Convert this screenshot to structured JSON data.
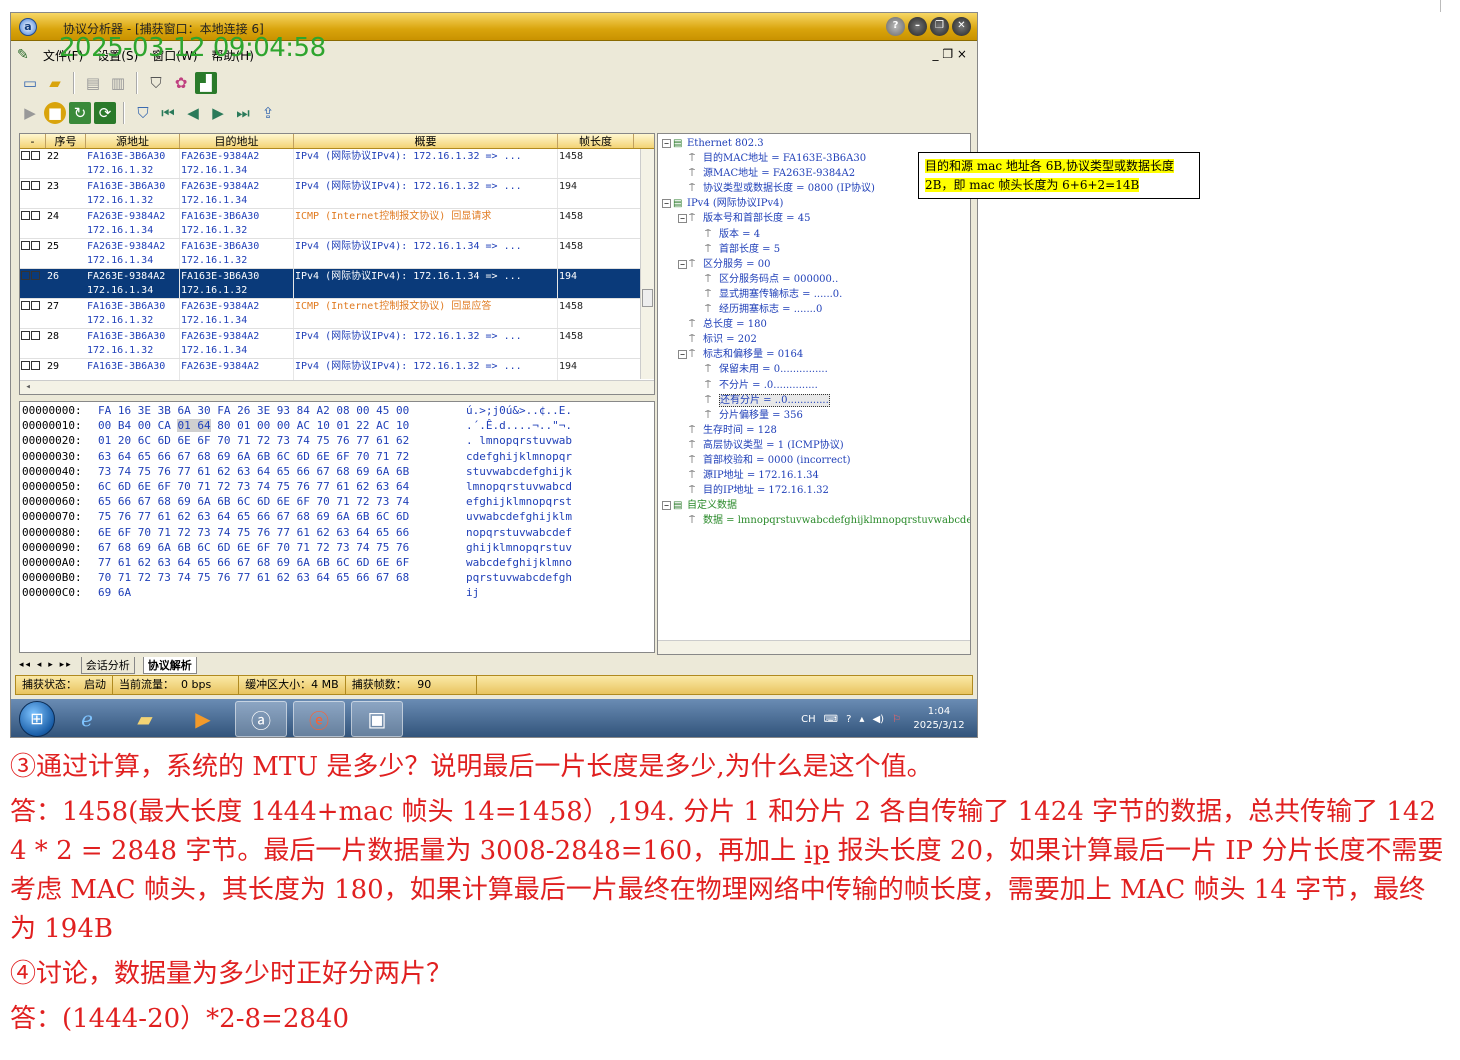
{
  "window": {
    "title": "协议分析器 - [捕获窗口：本地连接 6]",
    "timestamp_overlay": "2025-03-12 09:04:58",
    "buttons": [
      "?",
      "–",
      "❐",
      "✕"
    ]
  },
  "menu": {
    "items": [
      "文件(F)",
      "设置(S)",
      "窗口(W)",
      "帮助(H)"
    ],
    "mdi_controls": "_ ❐ ×"
  },
  "packet_list": {
    "columns": [
      "-",
      "序号",
      "源地址",
      "目的地址",
      "概要",
      "帧长度"
    ],
    "rows": [
      {
        "no": "22",
        "src": "FA163E-3B6A30",
        "src_ip": "172.16.1.32",
        "dst": "FA263E-9384A2",
        "dst_ip": "172.16.1.34",
        "summary": "IPv4 (网际协议IPv4): 172.16.1.32 => ...",
        "len": "1458",
        "type": "ipv4"
      },
      {
        "no": "23",
        "src": "FA163E-3B6A30",
        "src_ip": "172.16.1.32",
        "dst": "FA263E-9384A2",
        "dst_ip": "172.16.1.34",
        "summary": "IPv4 (网际协议IPv4): 172.16.1.32 => ...",
        "len": "194",
        "type": "ipv4"
      },
      {
        "no": "24",
        "src": "FA263E-9384A2",
        "src_ip": "172.16.1.34",
        "dst": "FA163E-3B6A30",
        "dst_ip": "172.16.1.32",
        "summary": "ICMP (Internet控制报文协议) 回显请求",
        "len": "1458",
        "type": "icmp"
      },
      {
        "no": "25",
        "src": "FA263E-9384A2",
        "src_ip": "172.16.1.34",
        "dst": "FA163E-3B6A30",
        "dst_ip": "172.16.1.32",
        "summary": "IPv4 (网际协议IPv4): 172.16.1.34 => ...",
        "len": "1458",
        "type": "ipv4"
      },
      {
        "no": "26",
        "src": "FA263E-9384A2",
        "src_ip": "172.16.1.34",
        "dst": "FA163E-3B6A30",
        "dst_ip": "172.16.1.32",
        "summary": "IPv4 (网际协议IPv4): 172.16.1.34 => ...",
        "len": "194",
        "type": "selected"
      },
      {
        "no": "27",
        "src": "FA163E-3B6A30",
        "src_ip": "172.16.1.32",
        "dst": "FA263E-9384A2",
        "dst_ip": "172.16.1.34",
        "summary": "ICMP (Internet控制报文协议) 回显应答",
        "len": "1458",
        "type": "icmp"
      },
      {
        "no": "28",
        "src": "FA163E-3B6A30",
        "src_ip": "172.16.1.32",
        "dst": "FA263E-9384A2",
        "dst_ip": "172.16.1.34",
        "summary": "IPv4 (网际协议IPv4): 172.16.1.32 => ...",
        "len": "1458",
        "type": "ipv4"
      },
      {
        "no": "29",
        "src": "FA163E-3B6A30",
        "src_ip": "",
        "dst": "FA263E-9384A2",
        "dst_ip": "",
        "summary": "IPv4 (网际协议IPv4): 172.16.1.32 => ...",
        "len": "194",
        "type": "ipv4"
      }
    ]
  },
  "hex": [
    {
      "off": "00000000:",
      "bytes": "FA 16 3E 3B 6A 30 FA 26 3E 93 84 A2 08 00 45 00",
      "ascii": "ú.>;j0ú&>..¢..E."
    },
    {
      "off": "00000010:",
      "bytes": "00 B4 00 CA 01 64 80 01 00 00 AC 10 01 22 AC 10",
      "ascii": ".´.Ê.d....¬..\"¬."
    },
    {
      "off": "00000020:",
      "bytes": "01 20 6C 6D 6E 6F 70 71 72 73 74 75 76 77 61 62",
      "ascii": ". lmnopqrstuvwab"
    },
    {
      "off": "00000030:",
      "bytes": "63 64 65 66 67 68 69 6A 6B 6C 6D 6E 6F 70 71 72",
      "ascii": "cdefghijklmnopqr"
    },
    {
      "off": "00000040:",
      "bytes": "73 74 75 76 77 61 62 63 64 65 66 67 68 69 6A 6B",
      "ascii": "stuvwabcdefghijk"
    },
    {
      "off": "00000050:",
      "bytes": "6C 6D 6E 6F 70 71 72 73 74 75 76 77 61 62 63 64",
      "ascii": "lmnopqrstuvwabcd"
    },
    {
      "off": "00000060:",
      "bytes": "65 66 67 68 69 6A 6B 6C 6D 6E 6F 70 71 72 73 74",
      "ascii": "efghijklmnopqrst"
    },
    {
      "off": "00000070:",
      "bytes": "75 76 77 61 62 63 64 65 66 67 68 69 6A 6B 6C 6D",
      "ascii": "uvwabcdefghijklm"
    },
    {
      "off": "00000080:",
      "bytes": "6E 6F 70 71 72 73 74 75 76 77 61 62 63 64 65 66",
      "ascii": "nopqrstuvwabcdef"
    },
    {
      "off": "00000090:",
      "bytes": "67 68 69 6A 6B 6C 6D 6E 6F 70 71 72 73 74 75 76",
      "ascii": "ghijklmnopqrstuv"
    },
    {
      "off": "000000A0:",
      "bytes": "77 61 62 63 64 65 66 67 68 69 6A 6B 6C 6D 6E 6F",
      "ascii": "wabcdefghijklmno"
    },
    {
      "off": "000000B0:",
      "bytes": "70 71 72 73 74 75 76 77 61 62 63 64 65 66 67 68",
      "ascii": "pqrstuvwabcdefgh"
    },
    {
      "off": "000000C0:",
      "bytes": "69 6A",
      "ascii": "ij"
    }
  ],
  "tree": [
    {
      "level": 0,
      "exp": "−",
      "node": true,
      "text": "Ethernet 802.3"
    },
    {
      "level": 1,
      "text": "目的MAC地址 = FA163E-3B6A30"
    },
    {
      "level": 1,
      "text": "源MAC地址 = FA263E-9384A2"
    },
    {
      "level": 1,
      "text": "协议类型或数据长度 = 0800 (IP协议)"
    },
    {
      "level": 0,
      "exp": "−",
      "node": true,
      "text": "IPv4 (网际协议IPv4)"
    },
    {
      "level": 1,
      "exp": "−",
      "text": "版本号和首部长度 = 45"
    },
    {
      "level": 2,
      "text": "版本 = 4"
    },
    {
      "level": 2,
      "text": "首部长度 = 5"
    },
    {
      "level": 1,
      "exp": "−",
      "text": "区分服务 = 00"
    },
    {
      "level": 2,
      "text": "区分服务码点 = 000000.."
    },
    {
      "level": 2,
      "text": "显式拥塞传输标志 = ......0."
    },
    {
      "level": 2,
      "text": "经历拥塞标志 = .......0"
    },
    {
      "level": 1,
      "text": "总长度 = 180"
    },
    {
      "level": 1,
      "text": "标识 = 202"
    },
    {
      "level": 1,
      "exp": "−",
      "text": "标志和偏移量 = 0164"
    },
    {
      "level": 2,
      "text": "保留未用 = 0..............."
    },
    {
      "level": 2,
      "text": "不分片 = .0.............."
    },
    {
      "level": 2,
      "text": "还有分片 = ..0.............",
      "hl": true
    },
    {
      "level": 2,
      "text": "分片偏移量 = 356"
    },
    {
      "level": 1,
      "text": "生存时间 = 128"
    },
    {
      "level": 1,
      "text": "高层协议类型 = 1 (ICMP协议)"
    },
    {
      "level": 1,
      "text": "首部校验和 = 0000 (incorrect)"
    },
    {
      "level": 1,
      "text": "源IP地址 = 172.16.1.34"
    },
    {
      "level": 1,
      "text": "目的IP地址 = 172.16.1.32"
    },
    {
      "level": 0,
      "exp": "−",
      "node": true,
      "text": "自定义数据",
      "green": true
    },
    {
      "level": 1,
      "text": "数据 = lmnopqrstuvwabcdefghijklmnopqrstuvwabcde",
      "green": true
    }
  ],
  "annotation": {
    "line1": "目的和源 mac 地址各 6B,协议类型或数据长度",
    "line2": "2B，即 mac 帧头长度为 6+6+2=14B"
  },
  "tabs": {
    "nav": "◂◂ ◂ ▸ ▸▸",
    "items": [
      "会话分析",
      "协议解析"
    ]
  },
  "status": {
    "capture_state": "捕获状态：",
    "capture_state_val": "启动",
    "current_flow": "当前流量：",
    "current_flow_val": "0 bps",
    "buffer": "缓冲区大小：4 MB",
    "frames": "捕获帧数：",
    "frames_val": "90"
  },
  "taskbar": {
    "lang": "CH",
    "time": "1:04",
    "date": "2025/3/12"
  },
  "doc": {
    "q3": "③通过计算，系统的 MTU 是多少？说明最后一片长度是多少,为什么是这个值。",
    "a3_pre": "答：1458(最大长度 1444+mac 帧头 14=1458）,194. 分片 1 和分片 2 各自传输了 1424 字节的数据，总共传输了 1424 * 2 = 2848 字节。最后一片数据量为 3008-2848=160，再加上 ",
    "a3_ip": "ip",
    "a3_post": " 报头长度 20，如果计算最后一片 IP 分片长度不需要考虑 MAC 帧头，其长度为 180，如果计算最后一片最终在物理网络中传输的帧长度，需要加上 MAC 帧头 14 字节，最终为 194B",
    "q4": "④讨论，数据量为多少时正好分两片？",
    "a4": "答：(1444-20）*2-8=2840"
  },
  "colors": {
    "title_bar": "#d9a40c",
    "selected_row": "#0a3a7a",
    "hex_blue": "#1f3fb8",
    "icmp_orange": "#e07a20",
    "doc_red": "#e02020",
    "timestamp_green": "#2ea52e"
  }
}
